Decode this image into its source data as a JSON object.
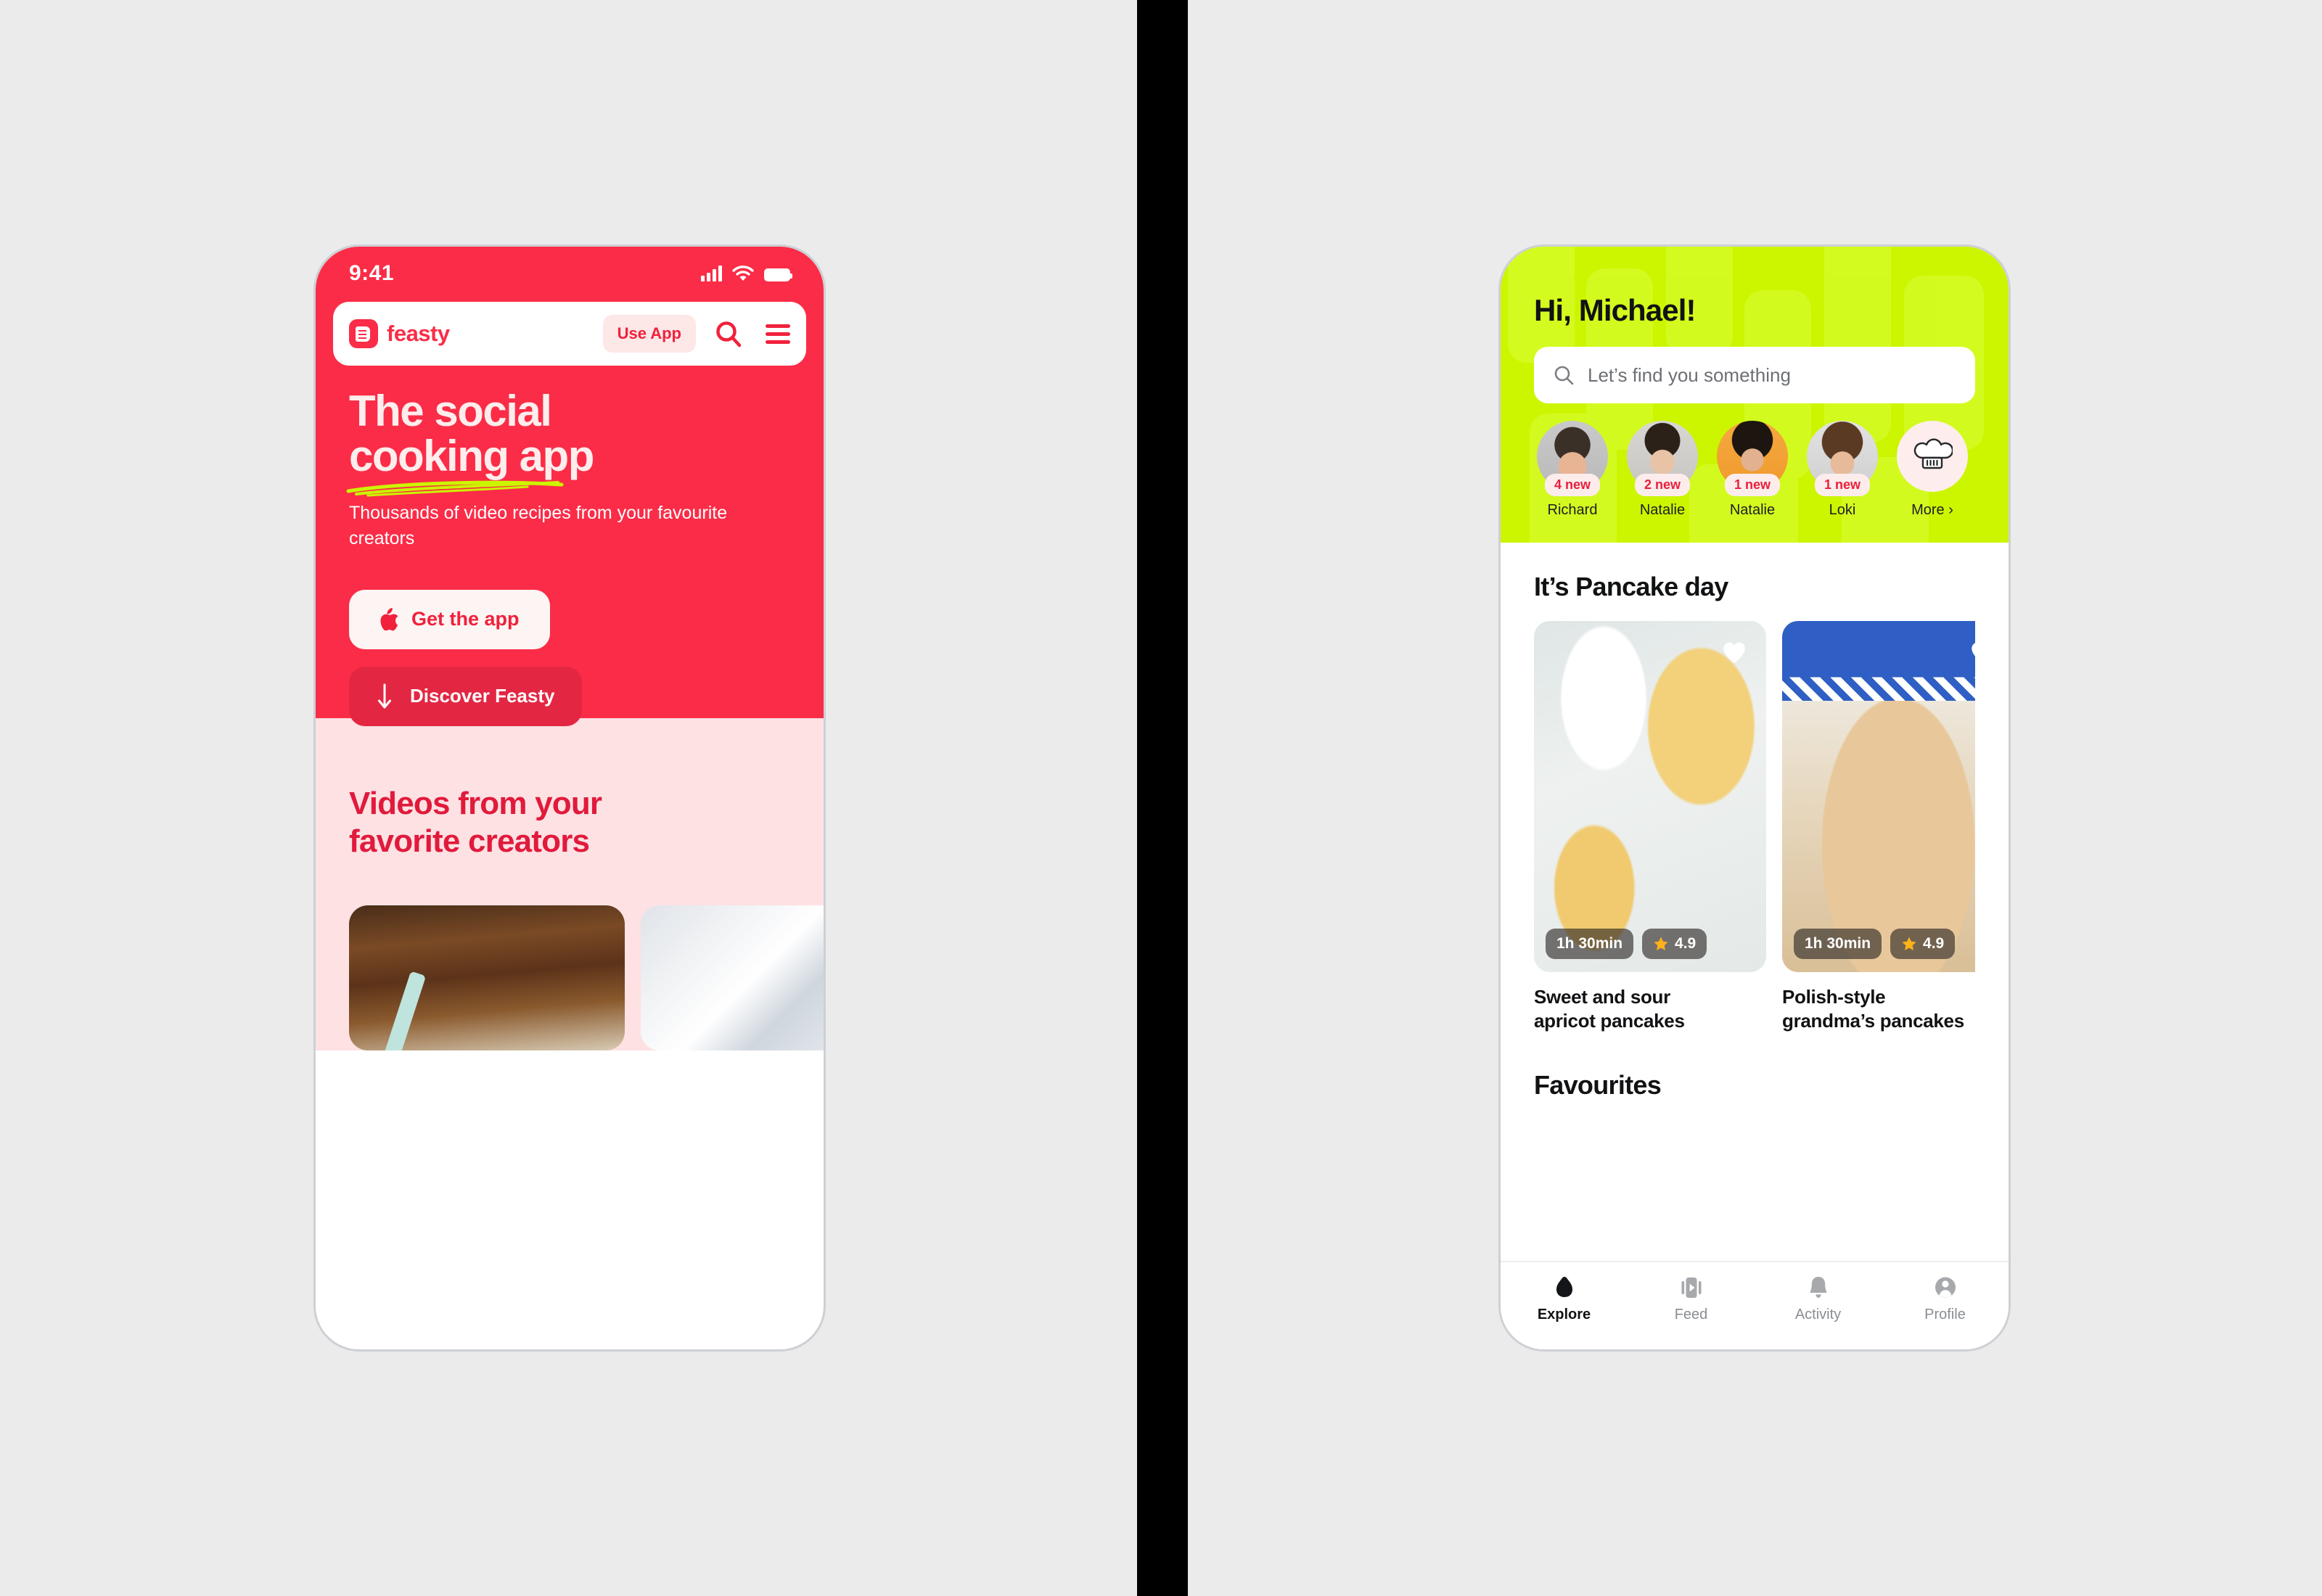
{
  "canvas": {
    "background_color": "#EBEBEB",
    "divider_color": "#000000"
  },
  "colors": {
    "brand_red": "#FB2C47",
    "deep_red": "#E11A3C",
    "soft_pink": "#FDE1E3",
    "cream": "#FDEDEC",
    "lime": "#CCF500",
    "ink": "#111214",
    "muted": "#8A8D92",
    "squiggle": "#CCF500"
  },
  "left_phone": {
    "status_bar": {
      "time": "9:41",
      "icons": [
        "signal-bars-icon",
        "wifi-icon",
        "battery-icon"
      ]
    },
    "navbar": {
      "logo_icon": "feasty-logo-icon",
      "brand_name": "feasty",
      "use_app_label": "Use App",
      "search_icon": "search-icon",
      "menu_icon": "hamburger-menu-icon"
    },
    "hero": {
      "title_line1": "The social",
      "title_line2": "cooking app",
      "subtitle": "Thousands of video recipes from your favourite creators",
      "primary_button": {
        "label": "Get the app",
        "icon": "apple-icon"
      },
      "secondary_button": {
        "label": "Discover Feasty",
        "icon": "arrow-down-icon"
      }
    },
    "creators_section": {
      "title_line1": "Videos from your",
      "title_line2": "favorite creators",
      "videos": [
        {
          "name": "video-thumb-wooden-board"
        },
        {
          "name": "video-thumb-marble-light"
        }
      ]
    }
  },
  "right_phone": {
    "header": {
      "greeting": "Hi, Michael!",
      "search_placeholder": "Let’s find you something",
      "search_icon": "search-icon"
    },
    "stories": [
      {
        "name": "Richard",
        "badge": "4 new",
        "avatar": "avatar-richard"
      },
      {
        "name": "Natalie",
        "badge": "2 new",
        "avatar": "avatar-natalie-1"
      },
      {
        "name": "Natalie",
        "badge": "1 new",
        "avatar": "avatar-natalie-2"
      },
      {
        "name": "Loki",
        "badge": "1 new",
        "avatar": "avatar-loki"
      },
      {
        "name": "More ›",
        "badge": "",
        "avatar": "chef-hat-icon"
      }
    ],
    "pancake_section": {
      "title": "It’s Pancake day",
      "cards": [
        {
          "title_line1": "Sweet and sour",
          "title_line2": "apricot pancakes",
          "time": "1h 30min",
          "rating": "4.9",
          "star_icon": "star-icon",
          "like_icon": "heart-icon",
          "image": "pancakes-apricot-photo"
        },
        {
          "title_line1": "Polish-style",
          "title_line2": "grandma’s pancakes",
          "time": "1h 30min",
          "rating": "4.9",
          "star_icon": "star-icon",
          "like_icon": "heart-icon",
          "image": "pancakes-polish-photo"
        }
      ]
    },
    "favourites_title": "Favourites",
    "tabbar": [
      {
        "label": "Explore",
        "icon": "home-icon",
        "active": true
      },
      {
        "label": "Feed",
        "icon": "feed-play-icon",
        "active": false
      },
      {
        "label": "Activity",
        "icon": "bell-icon",
        "active": false
      },
      {
        "label": "Profile",
        "icon": "person-icon",
        "active": false
      }
    ]
  }
}
